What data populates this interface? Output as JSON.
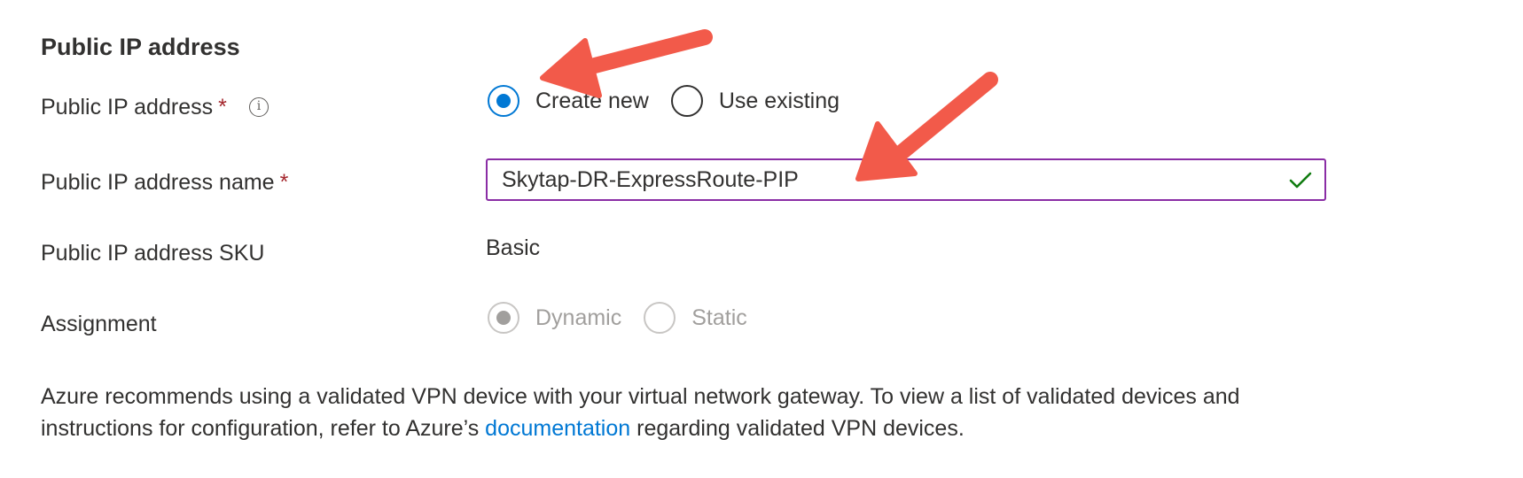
{
  "section": {
    "title": "Public IP address"
  },
  "fields": {
    "public_ip": {
      "label": "Public IP address",
      "required_mark": "*",
      "info_icon": "i",
      "options": [
        {
          "label": "Create new",
          "selected": true
        },
        {
          "label": "Use existing",
          "selected": false
        }
      ]
    },
    "public_ip_name": {
      "label": "Public IP address name",
      "required_mark": "*",
      "value": "Skytap-DR-ExpressRoute-PIP",
      "validation_icon": "checkmark-icon"
    },
    "sku": {
      "label": "Public IP address SKU",
      "value": "Basic"
    },
    "assignment": {
      "label": "Assignment",
      "options": [
        {
          "label": "Dynamic",
          "selected": true,
          "disabled": true
        },
        {
          "label": "Static",
          "selected": false,
          "disabled": true
        }
      ]
    }
  },
  "footer": {
    "text_before": "Azure recommends using a validated VPN device with your virtual network gateway. To view a list of validated devices and instructions for configuration, refer to Azure’s ",
    "link": "documentation",
    "text_after": " regarding validated VPN devices."
  },
  "colors": {
    "accent": "#0078d4",
    "required": "#a4262c",
    "input_border": "#8a2da5",
    "valid": "#107c10",
    "annotation_arrow": "#f25a4a"
  }
}
